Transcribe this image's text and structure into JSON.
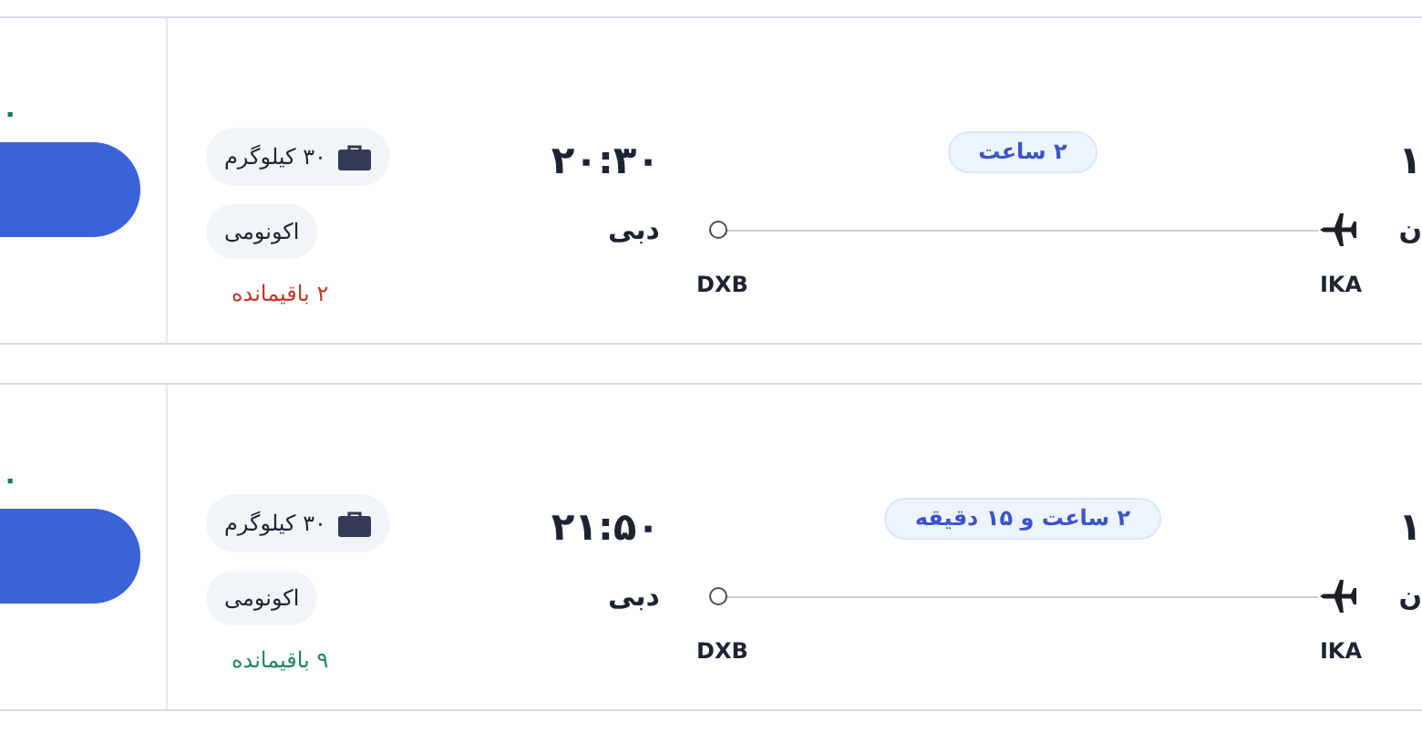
{
  "flights": [
    {
      "price_fragment": "۰",
      "baggage": "۳۰ کیلوگرم",
      "cabin_class": "اکونومی",
      "seats_left": {
        "text": "۲ باقیمانده",
        "color": "#c0392b"
      },
      "arrival_time": "۲۰:۳۰",
      "arrival_city": "دبی",
      "arrival_code": "DXB",
      "duration": "۲ ساعت",
      "departure_code": "IKA",
      "departure_time_fragment": "۱",
      "departure_city_fragment": "ن"
    },
    {
      "price_fragment": "۰",
      "baggage": "۳۰ کیلوگرم",
      "cabin_class": "اکونومی",
      "seats_left": {
        "text": "۹ باقیمانده",
        "color": "#1e8a5a"
      },
      "arrival_time": "۲۱:۵۰",
      "arrival_city": "دبی",
      "arrival_code": "DXB",
      "duration": "۲ ساعت و ۱۵ دقیقه",
      "departure_code": "IKA",
      "departure_time_fragment": "۱",
      "departure_city_fragment": "ن"
    }
  ]
}
